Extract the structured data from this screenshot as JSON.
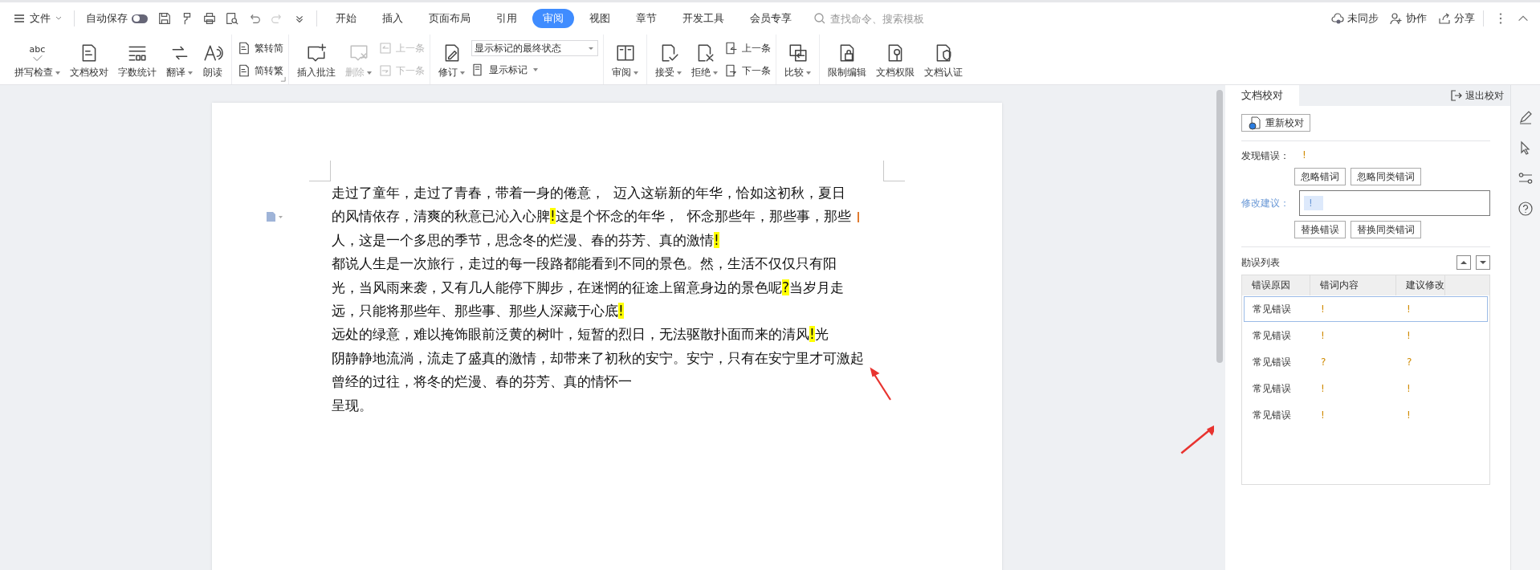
{
  "menu_bar": {
    "file_menu": "文件",
    "autosave": {
      "label": "自动保存",
      "on": false
    },
    "tabs": [
      {
        "label": "开始",
        "selected": false
      },
      {
        "label": "插入",
        "selected": false
      },
      {
        "label": "页面布局",
        "selected": false
      },
      {
        "label": "引用",
        "selected": false
      },
      {
        "label": "审阅",
        "selected": true
      },
      {
        "label": "视图",
        "selected": false
      },
      {
        "label": "章节",
        "selected": false
      },
      {
        "label": "开发工具",
        "selected": false
      },
      {
        "label": "会员专享",
        "selected": false
      }
    ],
    "search": {
      "placeholder": "查找命令、搜索模板"
    },
    "actions": [
      "未同步",
      "协作",
      "分享"
    ]
  },
  "ribbon": [
    {
      "items": [
        {
          "kind": "large",
          "label": "拼写检查",
          "dropdown": true,
          "disabled": false,
          "icon_text": "abc"
        },
        {
          "kind": "large",
          "label": "文档校对",
          "dropdown": false,
          "disabled": false
        },
        {
          "kind": "large",
          "label": "字数统计",
          "dropdown": false,
          "disabled": false
        },
        {
          "kind": "large",
          "label": "翻译",
          "dropdown": true,
          "disabled": false
        },
        {
          "kind": "large",
          "label": "朗读",
          "dropdown": false,
          "disabled": false
        }
      ]
    },
    {
      "items": [
        {
          "kind": "stack",
          "items": [
            {
              "kind": "small",
              "label": "繁转简",
              "dropdown": false,
              "disabled": false
            },
            {
              "kind": "small",
              "label": "简转繁",
              "dropdown": false,
              "disabled": false
            }
          ]
        }
      ],
      "expander": true
    },
    {
      "items": [
        {
          "kind": "large",
          "label": "插入批注",
          "dropdown": false,
          "disabled": false
        },
        {
          "kind": "large",
          "label": "删除",
          "dropdown": true,
          "disabled": true
        },
        {
          "kind": "stack",
          "items": [
            {
              "kind": "small",
              "label": "上一条",
              "dropdown": false,
              "disabled": true
            },
            {
              "kind": "small",
              "label": "下一条",
              "dropdown": false,
              "disabled": true
            }
          ]
        }
      ]
    },
    {
      "items": [
        {
          "kind": "large",
          "label": "修订",
          "dropdown": true,
          "disabled": false
        },
        {
          "kind": "stack",
          "items": [
            {
              "kind": "select",
              "value": "显示标记的最终状态"
            },
            {
              "kind": "small",
              "label": "显示标记",
              "dropdown": true,
              "disabled": false
            }
          ]
        }
      ]
    },
    {
      "items": [
        {
          "kind": "large",
          "label": "审阅",
          "dropdown": true,
          "disabled": false
        }
      ]
    },
    {
      "items": [
        {
          "kind": "large",
          "label": "接受",
          "dropdown": true,
          "disabled": false
        },
        {
          "kind": "large",
          "label": "拒绝",
          "dropdown": true,
          "disabled": false
        },
        {
          "kind": "stack",
          "items": [
            {
              "kind": "small",
              "label": "上一条",
              "dropdown": false,
              "disabled": false
            },
            {
              "kind": "small",
              "label": "下一条",
              "dropdown": false,
              "disabled": false
            }
          ]
        }
      ]
    },
    {
      "items": [
        {
          "kind": "large",
          "label": "比较",
          "dropdown": true,
          "disabled": false
        }
      ]
    },
    {
      "items": [
        {
          "kind": "large",
          "label": "限制编辑",
          "dropdown": false,
          "disabled": false
        },
        {
          "kind": "large",
          "label": "文档权限",
          "dropdown": false,
          "disabled": false
        },
        {
          "kind": "large",
          "label": "文档认证",
          "dropdown": false,
          "disabled": false
        }
      ]
    }
  ],
  "document": {
    "lines": [
      [
        {
          "text": "走过了童年，走过了青春，带着一身的倦意，  迈入这崭新的年华，恰如这初秋，夏日",
          "highlighted": false
        }
      ],
      [
        {
          "text": "的风情依存，清爽的秋意已沁入心脾",
          "highlighted": false
        },
        {
          "text": "!",
          "highlighted": true
        },
        {
          "text": "这是个怀念的年华，  怀念那些年，那些事，那些",
          "highlighted": false
        }
      ],
      [
        {
          "text": "人，这是一个多思的季节，思念冬的烂漫、春的芬芳、真的激情",
          "highlighted": false
        },
        {
          "text": "!",
          "highlighted": true
        }
      ],
      [
        {
          "text": "都说人生是一次旅行，走过的每一段路都能看到不同的景色。然，生活不仅仅只有阳",
          "highlighted": false
        }
      ],
      [
        {
          "text": "光，当风雨来袭，又有几人能停下脚步，在迷惘的征途上留意身边的景色呢",
          "highlighted": false
        },
        {
          "text": "?",
          "highlighted": true
        },
        {
          "text": "当岁月走",
          "highlighted": false
        }
      ],
      [
        {
          "text": "远，只能将那些年、那些事、那些人深藏于心底",
          "highlighted": false
        },
        {
          "text": "!",
          "highlighted": true
        }
      ],
      [
        {
          "text": "远处的绿意，难以掩饰眼前泛黄的树叶，短暂的烈日，无法驱散扑面而来的清风",
          "highlighted": false
        },
        {
          "text": "!",
          "highlighted": true
        },
        {
          "text": "光",
          "highlighted": false
        }
      ],
      [
        {
          "text": "阴静静地流淌，流走了盛真的激情，却带来了初秋的安宁。安宁，只有在安宁里才可激起",
          "highlighted": false
        }
      ],
      [
        {
          "text": "曾经的过往，将冬的烂漫、春的芬芳、真的情怀一",
          "highlighted": false
        }
      ],
      [
        {
          "text": "呈现。",
          "highlighted": false
        }
      ]
    ]
  },
  "proofread_panel": {
    "tab": {
      "label": "文档校对",
      "selected": true
    },
    "exit": "退出校对",
    "recheck": "重新校对",
    "found_label": "发现错误：",
    "found_value": "!",
    "ignore_buttons": [
      "忽略错词",
      "忽略同类错词"
    ],
    "suggestion_label": "修改建议：",
    "suggestions": [
      {
        "text": "!",
        "selected": true
      }
    ],
    "replace_buttons": [
      "替换错误",
      "替换同类错词"
    ],
    "list_title": "勘误列表",
    "columns": [
      "错误原因",
      "错词内容",
      "建议修改"
    ],
    "rows": [
      {
        "cells": [
          "常见错误",
          "!",
          "!"
        ],
        "selected": true
      },
      {
        "cells": [
          "常见错误",
          "!",
          "!"
        ],
        "selected": false
      },
      {
        "cells": [
          "常见错误",
          "?",
          "?"
        ],
        "selected": false
      },
      {
        "cells": [
          "常见错误",
          "!",
          "!"
        ],
        "selected": false
      },
      {
        "cells": [
          "常见错误",
          "!",
          "!"
        ],
        "selected": false
      }
    ]
  }
}
